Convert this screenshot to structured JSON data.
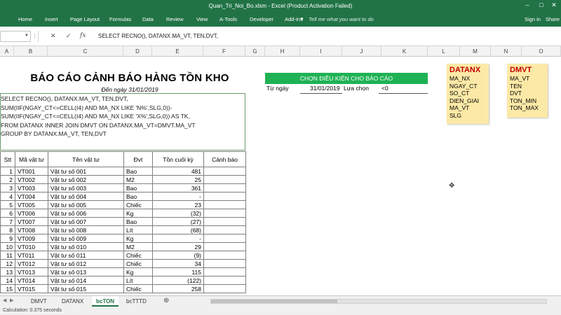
{
  "window": {
    "title": "Quan_Tri_Noi_Bo.xlsm - Excel (Product Activation Failed)"
  },
  "ribbon": {
    "tabs": [
      "Home",
      "Insert",
      "Page Layout",
      "Formulas",
      "Data",
      "Review",
      "View",
      "A-Tools",
      "Developer",
      "Add-Ins"
    ],
    "tell_me": "Tell me what you want to do",
    "sign_in": "Sign in",
    "share": "Share"
  },
  "formula_bar": {
    "formula": "SELECT RECNO(), DATANX.MA_VT, TEN,DVT,"
  },
  "columns": [
    "A",
    "B",
    "C",
    "D",
    "E",
    "F",
    "G",
    "H",
    "I",
    "J",
    "K",
    "L",
    "M",
    "N",
    "O"
  ],
  "report": {
    "title": "BÁO CÁO CẢNH BÁO HÀNG TỒN KHO",
    "date": "Đến ngày 31/01/2019",
    "sql": [
      "SELECT RECNO(), DATANX.MA_VT, TEN,DVT,",
      "SUM(IIF(NGAY_CT<=CELL(I4) AND MA_NX LIKE 'N%',SLG,0))-",
      "SUM(IIF(NGAY_CT<=CELL(I4) AND MA_NX LIKE 'X%',SLG,0)) AS TK,",
      "FROM DATANX INNER JOIN DMVT ON DATANX.MA_VT=DMVT.MA_VT",
      "GROUP BY DATANX.MA_VT, TEN,DVT"
    ],
    "headers": [
      "Stt",
      "Mã vật tư",
      "Tên vật tư",
      "Đvt",
      "Tồn cuối kỳ",
      "Cảnh báo"
    ],
    "rows": [
      [
        "1",
        "VT001",
        "Vật tư số 001",
        "Bao",
        "481",
        ""
      ],
      [
        "2",
        "VT002",
        "Vật tư số 002",
        "M2",
        "25",
        ""
      ],
      [
        "3",
        "VT003",
        "Vật tư số 003",
        "Bao",
        "361",
        ""
      ],
      [
        "4",
        "VT004",
        "Vật tư số 004",
        "Bao",
        "-",
        ""
      ],
      [
        "5",
        "VT005",
        "Vật tư số 005",
        "Chiếc",
        "23",
        ""
      ],
      [
        "6",
        "VT006",
        "Vật tư số 006",
        "Kg",
        "(32)",
        ""
      ],
      [
        "7",
        "VT007",
        "Vật tư số 007",
        "Bao",
        "(27)",
        ""
      ],
      [
        "8",
        "VT008",
        "Vật tư số 008",
        "Lít",
        "(68)",
        ""
      ],
      [
        "9",
        "VT009",
        "Vật tư số 009",
        "Kg",
        "-",
        ""
      ],
      [
        "10",
        "VT010",
        "Vật tư số 010",
        "M2",
        "29",
        ""
      ],
      [
        "11",
        "VT011",
        "Vật tư số 011",
        "Chiếc",
        "(9)",
        ""
      ],
      [
        "12",
        "VT012",
        "Vật tư số 012",
        "Chiếc",
        "34",
        ""
      ],
      [
        "13",
        "VT013",
        "Vật tư số 013",
        "Kg",
        "115",
        ""
      ],
      [
        "14",
        "VT014",
        "Vật tư số 014",
        "Lít",
        "(122)",
        ""
      ],
      [
        "15",
        "VT015",
        "Vật tư số 015",
        "Chiếc",
        "258",
        ""
      ]
    ]
  },
  "criteria": {
    "header": "CHỌN ĐIỀU KIỆN CHO BÁO CÁO",
    "from_label": "Từ ngày",
    "from_value": "31/01/2019",
    "choice_label": "Lựa chọn",
    "choice_value": "<0"
  },
  "datanx_box": {
    "title": "DATANX",
    "fields": [
      "MA_NX",
      "NGAY_CT",
      "SO_CT",
      "DIEN_GIAI",
      "MA_VT",
      "SLG"
    ]
  },
  "dmvt_box": {
    "title": "DMVT",
    "fields": [
      "MA_VT",
      "TEN",
      "DVT",
      "TON_MIN",
      "TON_MAX"
    ]
  },
  "sheets": {
    "tabs": [
      "DMVT",
      "DATANX",
      "bcTON",
      "bcTTTD"
    ],
    "active": "bcTON"
  },
  "status": {
    "text": "Calculation: 0.375 seconds"
  }
}
